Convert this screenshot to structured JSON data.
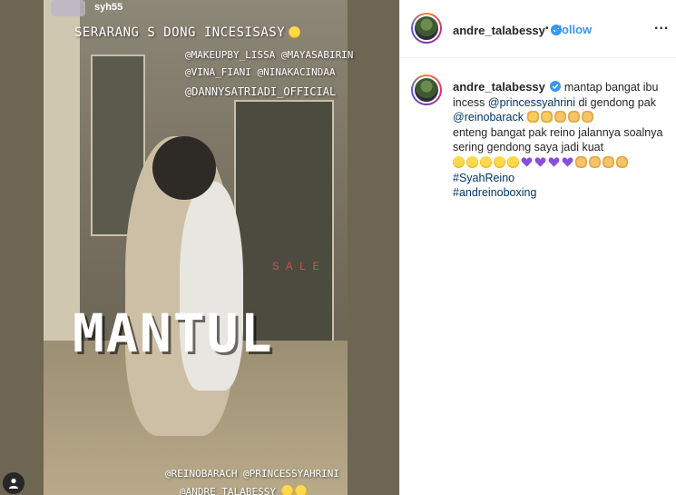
{
  "media": {
    "story_username": "syh55",
    "overlay_headline": "SERARANG S  DONG INCESISASY",
    "overlay_tags_1": "@MAKEUPBY_LISSA @MAYASABIRIN",
    "overlay_tags_2": "@VINA_FIANI @NINAKACINDAA",
    "overlay_tags_3": "@DANNYSATRIADI_OFFICIAL",
    "overlay_big": "MANTUL",
    "overlay_bottom_1": "@REINOBARACH @PRINCESSYAHRINI",
    "overlay_bottom_2": "@ANDRE_TALABESSY",
    "sign_text": "SALE",
    "user_tag_icon": "user-icon"
  },
  "header": {
    "username": "andre_talabessy",
    "verified_icon": "verified-badge-icon",
    "separator": "•",
    "follow_label": "Follow",
    "more_label": "..."
  },
  "caption": {
    "username": "andre_talabessy",
    "text_1": "mantap bangat ibu incess",
    "mention_1": "@princessyahrini",
    "text_2": "di gendong pak",
    "mention_2": "@reinobarack",
    "line_2": "enteng bangat pak reino jalannya soalnya sering gendong saya jadi kuat",
    "hashtag_1": "#SyahReino",
    "hashtag_2": "#andreinoboxing"
  },
  "colors": {
    "link_blue": "#3897f0",
    "mention_blue": "#003569",
    "verified_blue": "#3897f0"
  }
}
